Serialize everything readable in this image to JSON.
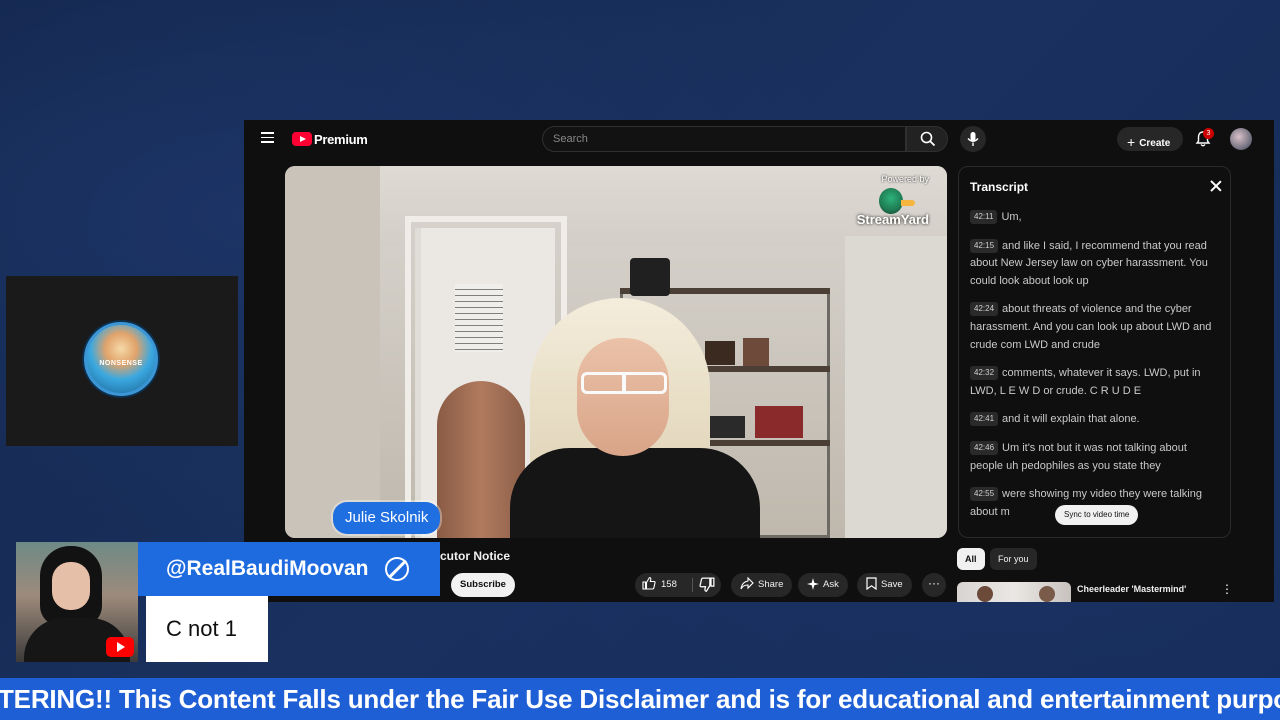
{
  "youtube": {
    "logo_label": "Premium",
    "search_placeholder": "Search",
    "create_label": "Create",
    "notification_count": "3",
    "video_title": "cutor Notice",
    "subscribe_label": "Subscribe",
    "like_count": "158",
    "share_label": "Share",
    "ask_label": "Ask",
    "save_label": "Save",
    "chips": [
      {
        "label": "All",
        "active": true
      },
      {
        "label": "For you",
        "active": false
      }
    ],
    "recommendation_title": "Cheerleader 'Mastermind'"
  },
  "player": {
    "powered_by": "Powered by",
    "brand": "StreamYard",
    "name_tag": "Julie Skolnik"
  },
  "transcript": {
    "title": "Transcript",
    "segments": [
      {
        "time": "42:11",
        "text": "Um,"
      },
      {
        "time": "42:15",
        "text": "and like I said, I recommend that you read about New Jersey law on cyber harassment. You could look about look up"
      },
      {
        "time": "42:24",
        "text": "about threats of violence and the cyber harassment. And you can look up about LWD and crude com LWD and crude"
      },
      {
        "time": "42:32",
        "text": "comments, whatever it says. LWD, put in LWD, L E W D or crude. C R U D E"
      },
      {
        "time": "42:41",
        "text": "and it will explain that alone."
      },
      {
        "time": "42:46",
        "text": "Um it's not but it was not talking about people uh pedophiles as you state they"
      },
      {
        "time": "42:55",
        "text": "were showing my video they were talking about m"
      }
    ],
    "sync_label": "Sync to video time"
  },
  "overlay": {
    "logo_text": "NONSENSE",
    "handle": "@RealBaudiMoovan",
    "subtext": "C not 1",
    "ticker": "TERING!! This Content Falls under the Fair Use Disclaimer and is for educational and entertainment purpose"
  },
  "colors": {
    "background": "#152a52",
    "overlay_blue": "#1e6be0",
    "youtube_red": "#ff0033",
    "youtube_dark": "#0f0f0f"
  }
}
